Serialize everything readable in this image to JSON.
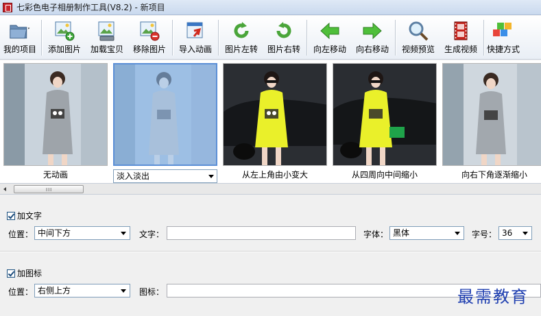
{
  "window": {
    "title": "七彩色电子相册制作工具(V8.2) - 新项目"
  },
  "toolbar": {
    "items": [
      {
        "label": "我的项目",
        "icon": "folder-icon"
      },
      {
        "label": "添加图片",
        "icon": "add-image-icon"
      },
      {
        "label": "加载宝贝",
        "icon": "load-item-icon"
      },
      {
        "label": "移除图片",
        "icon": "remove-image-icon"
      },
      {
        "label": "导入动画",
        "icon": "import-animation-icon"
      },
      {
        "label": "图片左转",
        "icon": "rotate-left-icon"
      },
      {
        "label": "图片右转",
        "icon": "rotate-right-icon"
      },
      {
        "label": "向左移动",
        "icon": "move-left-icon"
      },
      {
        "label": "向右移动",
        "icon": "move-right-icon"
      },
      {
        "label": "视频预览",
        "icon": "magnifier-icon"
      },
      {
        "label": "生成视频",
        "icon": "film-icon"
      },
      {
        "label": "快捷方式",
        "icon": "cubes-icon"
      }
    ]
  },
  "thumbnails": [
    {
      "caption": "无动画"
    },
    {
      "caption": "淡入淡出"
    },
    {
      "caption": "从左上角由小变大"
    },
    {
      "caption": "从四周向中间缩小"
    },
    {
      "caption": "向右下角逐渐缩小"
    }
  ],
  "text_section": {
    "checkbox_label": "加文字",
    "position_label": "位置：",
    "position_value": "中间下方",
    "text_label": "文字：",
    "text_value": "",
    "font_label": "字体：",
    "font_value": "黑体",
    "size_label": "字号：",
    "size_value": "36"
  },
  "logo_section": {
    "checkbox_label": "加图标",
    "position_label": "位置：",
    "position_value": "右侧上方",
    "logo_label": "图标：",
    "logo_value": ""
  },
  "watermark": "最需教育",
  "scrollbar": {
    "grip": "III"
  }
}
